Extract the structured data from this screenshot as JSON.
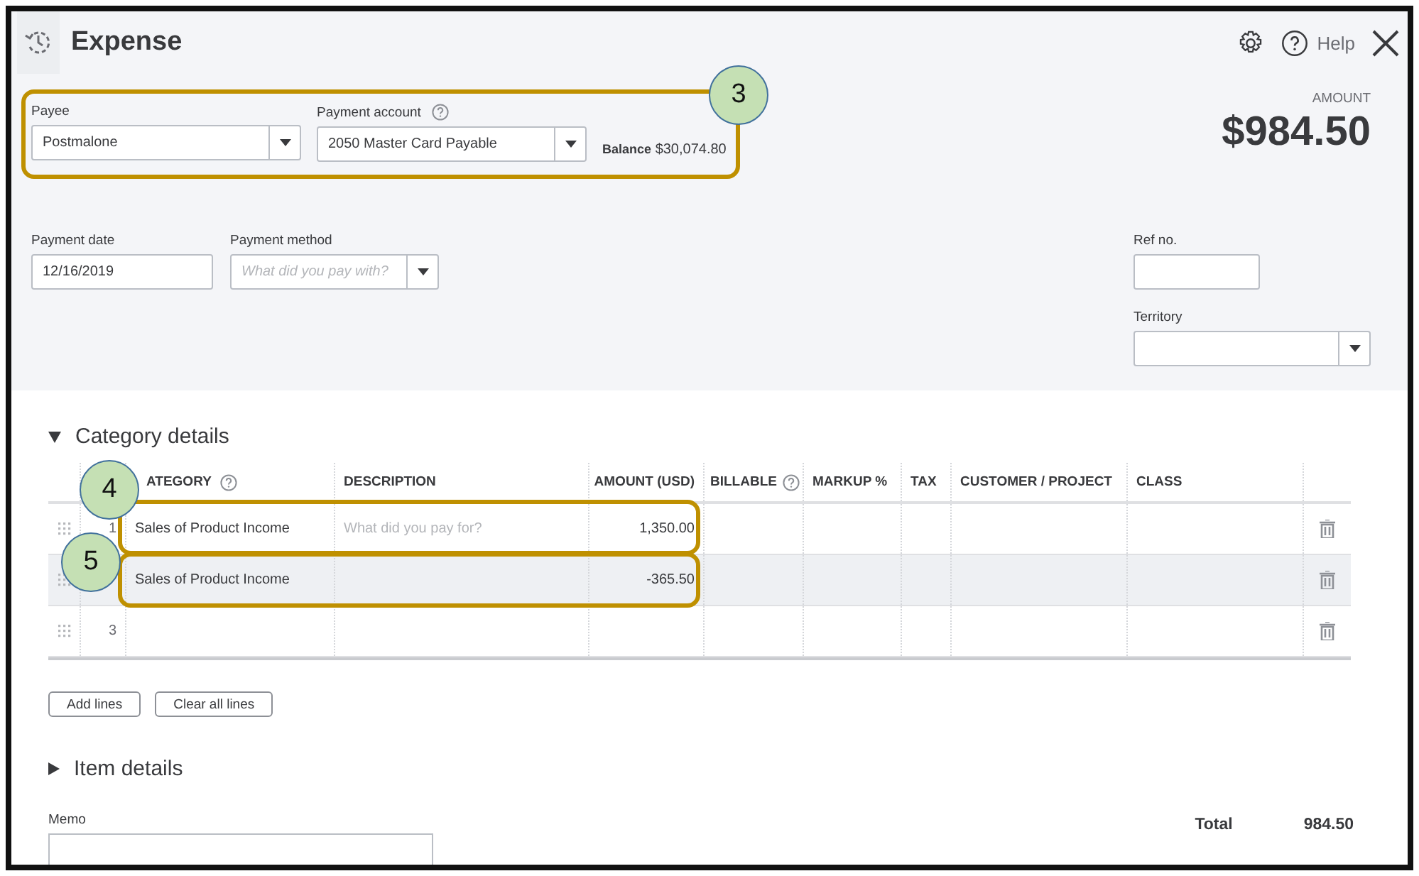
{
  "window": {
    "title": "Expense",
    "help": "Help"
  },
  "amount": {
    "label": "AMOUNT",
    "value": "$984.50"
  },
  "payee": {
    "label": "Payee",
    "value": "Postmalone"
  },
  "payment_account": {
    "label": "Payment account",
    "value": "2050 Master Card Payable",
    "balance_label": "Balance",
    "balance": "$30,074.80"
  },
  "payment_date": {
    "label": "Payment date",
    "value": "12/16/2019"
  },
  "payment_method": {
    "label": "Payment method",
    "placeholder": "What did you pay with?"
  },
  "ref_no": {
    "label": "Ref no."
  },
  "territory": {
    "label": "Territory"
  },
  "category_details": {
    "title": "Category details",
    "expanded": true,
    "columns": [
      {
        "label": "ATEGORY",
        "help": true
      },
      {
        "label": "DESCRIPTION",
        "help": false
      },
      {
        "label": "AMOUNT (USD)",
        "help": false
      },
      {
        "label": "BILLABLE",
        "help": true
      },
      {
        "label": "MARKUP %",
        "help": false
      },
      {
        "label": "TAX",
        "help": false
      },
      {
        "label": "CUSTOMER / PROJECT",
        "help": false
      },
      {
        "label": "CLASS",
        "help": false
      }
    ],
    "rows": [
      {
        "number": "1",
        "category": "Sales of Product Income",
        "description_placeholder": "What did you pay for?",
        "amount": "1,350.00",
        "selected": false
      },
      {
        "category": "Sales of Product Income",
        "amount": "-365.50",
        "selected": true
      },
      {
        "number": "3",
        "selected": false
      }
    ]
  },
  "buttons": [
    "Add lines",
    "Clear all lines"
  ],
  "item_details": {
    "title": "Item details",
    "expanded": false
  },
  "memo": {
    "label": "Memo"
  },
  "total": {
    "label": "Total",
    "value": "984.50"
  },
  "annotations": [
    {
      "label": "3"
    },
    {
      "label": "4"
    },
    {
      "label": "5"
    }
  ]
}
